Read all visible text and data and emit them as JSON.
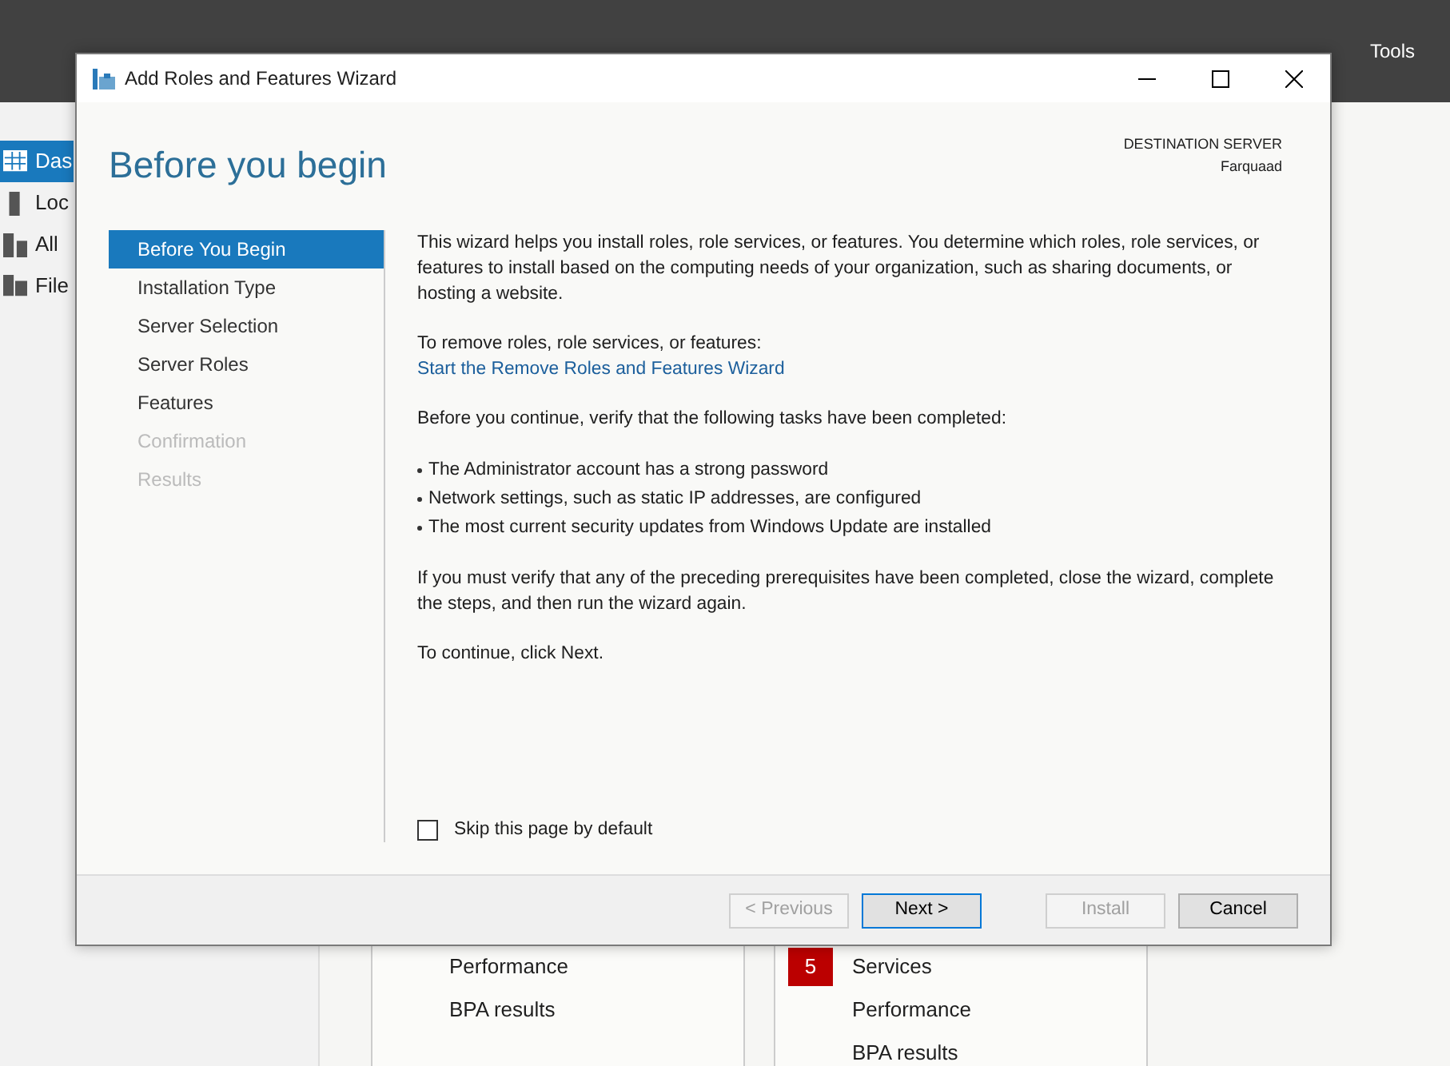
{
  "background": {
    "toolbar": {
      "menu": "Tools"
    },
    "sidebar": {
      "items": [
        {
          "label": "Das",
          "selected": true
        },
        {
          "label": "Loc",
          "selected": false
        },
        {
          "label": "All",
          "selected": false
        },
        {
          "label": "File",
          "selected": false
        }
      ]
    },
    "tiles": [
      {
        "rows": [
          {
            "badge": "",
            "label": "Performance"
          },
          {
            "badge": "",
            "label": "BPA results"
          }
        ]
      },
      {
        "rows": [
          {
            "badge": "5",
            "label": "Services"
          },
          {
            "badge": "",
            "label": "Performance"
          },
          {
            "badge": "",
            "label": "BPA results"
          }
        ]
      }
    ]
  },
  "wizard": {
    "title": "Add Roles and Features Wizard",
    "heading": "Before you begin",
    "destination_label": "DESTINATION SERVER",
    "destination_server": "Farquaad",
    "steps": [
      {
        "label": "Before You Begin",
        "selected": true,
        "disabled": false
      },
      {
        "label": "Installation Type",
        "selected": false,
        "disabled": false
      },
      {
        "label": "Server Selection",
        "selected": false,
        "disabled": false
      },
      {
        "label": "Server Roles",
        "selected": false,
        "disabled": false
      },
      {
        "label": "Features",
        "selected": false,
        "disabled": false
      },
      {
        "label": "Confirmation",
        "selected": false,
        "disabled": true
      },
      {
        "label": "Results",
        "selected": false,
        "disabled": true
      }
    ],
    "content": [
      {
        "kind": "paragraph",
        "text": "This wizard helps you install roles, role services, or features. You determine which roles, role services, or features to install based on the computing needs of your organization, such as sharing documents, or hosting a website."
      },
      {
        "kind": "paragraph",
        "text": "To remove roles, role services, or features:",
        "link": "Start the Remove Roles and Features Wizard"
      },
      {
        "kind": "paragraph",
        "text": "Before you continue, verify that the following tasks have been completed:"
      },
      {
        "kind": "bullets",
        "items": [
          "The Administrator account has a strong password",
          "Network settings, such as static IP addresses, are configured",
          "The most current security updates from Windows Update are installed"
        ]
      },
      {
        "kind": "paragraph",
        "text": "If you must verify that any of the preceding prerequisites have been completed, close the wizard, complete the steps, and then run the wizard again."
      },
      {
        "kind": "paragraph",
        "text": "To continue, click Next."
      }
    ],
    "skip_checkbox": {
      "label": "Skip this page by default",
      "checked": false
    },
    "buttons": [
      {
        "label": "< Previous",
        "disabled": true,
        "default": false
      },
      {
        "label": "Next >",
        "disabled": false,
        "default": true
      },
      {
        "label": "Install",
        "disabled": true,
        "default": false
      },
      {
        "label": "Cancel",
        "disabled": false,
        "default": false
      }
    ]
  }
}
